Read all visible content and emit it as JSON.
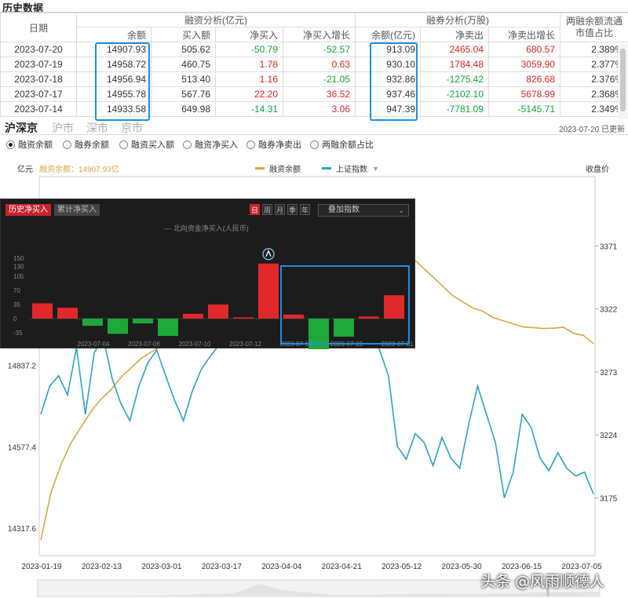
{
  "header": {
    "title": "历史数据"
  },
  "table": {
    "group_headers": {
      "date": "日期",
      "financing": "融资分析(亿元)",
      "securities": "融券分析(万股)",
      "ratio": "两融余额流通市值占比"
    },
    "columns": [
      "余额",
      "买入额",
      "净买入",
      "净买入增长",
      "余额(亿元)",
      "净卖出",
      "净卖出增长"
    ],
    "rows": [
      {
        "date": "2023-07-20",
        "fin_balance": "14907.93",
        "buy": "505.62",
        "net_buy": "-50.79",
        "net_buy_growth": "-52.57",
        "sec_balance": "913.09",
        "net_sell": "2465.04",
        "net_sell_growth": "680.57",
        "ratio": "2.389%"
      },
      {
        "date": "2023-07-19",
        "fin_balance": "14958.72",
        "buy": "460.75",
        "net_buy": "1.78",
        "net_buy_growth": "0.63",
        "sec_balance": "930.10",
        "net_sell": "1784.48",
        "net_sell_growth": "3059.90",
        "ratio": "2.377%"
      },
      {
        "date": "2023-07-18",
        "fin_balance": "14956.94",
        "buy": "513.40",
        "net_buy": "1.16",
        "net_buy_growth": "-21.05",
        "sec_balance": "932.86",
        "net_sell": "-1275.42",
        "net_sell_growth": "826.68",
        "ratio": "2.376%"
      },
      {
        "date": "2023-07-17",
        "fin_balance": "14955.78",
        "buy": "567.76",
        "net_buy": "22.20",
        "net_buy_growth": "36.52",
        "sec_balance": "937.46",
        "net_sell": "-2102.10",
        "net_sell_growth": "5678.99",
        "ratio": "2.368%"
      },
      {
        "date": "2023-07-14",
        "fin_balance": "14933.58",
        "buy": "649.98",
        "net_buy": "-14.31",
        "net_buy_growth": "3.06",
        "sec_balance": "947.39",
        "net_sell": "-7781.09",
        "net_sell_growth": "-5145.71",
        "ratio": "2.349%"
      }
    ]
  },
  "market_tabs": [
    {
      "label": "沪深京",
      "active": true
    },
    {
      "label": "沪市",
      "active": false
    },
    {
      "label": "深市",
      "active": false
    },
    {
      "label": "京市",
      "active": false
    }
  ],
  "updated": "2023-07-20 已更新",
  "radio_options": [
    {
      "label": "融资余额",
      "selected": true
    },
    {
      "label": "融券余额",
      "selected": false
    },
    {
      "label": "融资买入额",
      "selected": false
    },
    {
      "label": "融资净买入",
      "selected": false
    },
    {
      "label": "融券净卖出",
      "selected": false
    },
    {
      "label": "两融余额占比",
      "selected": false
    }
  ],
  "main_legend": {
    "unit": "亿元",
    "current": "融资余额：14907.93亿",
    "series_a": "融资余额",
    "series_b": "上证指数",
    "right_title": "收盘价"
  },
  "overlay": {
    "tab_active": "历史净买入",
    "tab_other": "累计净买入",
    "periods": [
      "日",
      "周",
      "月",
      "季",
      "年"
    ],
    "select_label": "叠加指数",
    "legend": "北向资金净买入(人民币)"
  },
  "watermark": "头条 @风雨顺德人",
  "colors": {
    "gold": "#d8a740",
    "blue": "#2aa3c6",
    "red": "#e0232b",
    "green": "#15a33a",
    "highlight": "#1a8fe3"
  },
  "chart_data": [
    {
      "type": "line",
      "title": "",
      "x_ticks": [
        "2023-01-19",
        "2023-02-13",
        "2023-03-01",
        "2023-03-17",
        "2023-04-04",
        "2023-04-21",
        "2023-05-12",
        "2023-05-30",
        "2023-06-15",
        "2023-07-05"
      ],
      "left_axis": {
        "unit": "亿元",
        "ticks": [
          14317.6,
          14577.4,
          14837.2
        ],
        "ylim": [
          14230,
          15440
        ]
      },
      "right_axis": {
        "title": "收盘价",
        "ticks": [
          3175,
          3224,
          3273,
          3322,
          3371
        ],
        "ylim": [
          3130,
          3425
        ]
      },
      "series": [
        {
          "name": "融资余额",
          "axis": "left",
          "color": "#d8a740",
          "values": [
            14280,
            14430,
            14520,
            14590,
            14640,
            14690,
            14730,
            14760,
            14800,
            14830,
            14860,
            14880,
            14900,
            14920,
            14960,
            15000,
            15050,
            15110,
            15170,
            15230,
            15290,
            15300,
            15330,
            15320,
            15300,
            15330,
            15310,
            15290,
            15300,
            15320,
            15300,
            15270,
            15260,
            15250,
            15220,
            15210,
            15200,
            15180,
            15150,
            15120,
            15090,
            15060,
            15040,
            15020,
            15010,
            14990,
            14980,
            14970,
            14960,
            14958,
            14955,
            14956,
            14959,
            14940,
            14933,
            14907
          ]
        },
        {
          "name": "上证指数",
          "axis": "right",
          "color": "#2aa3c6",
          "values": [
            3240,
            3262,
            3270,
            3255,
            3292,
            3240,
            3288,
            3300,
            3268,
            3248,
            3235,
            3262,
            3280,
            3290,
            3270,
            3251,
            3235,
            3258,
            3275,
            3285,
            3294,
            3300,
            3310,
            3322,
            3330,
            3340,
            3336,
            3348,
            3330,
            3320,
            3345,
            3355,
            3325,
            3310,
            3300,
            3330,
            3342,
            3318,
            3290,
            3270,
            3215,
            3205,
            3225,
            3218,
            3200,
            3222,
            3206,
            3198,
            3232,
            3262,
            3240,
            3218,
            3175,
            3195,
            3240,
            3230,
            3206,
            3196,
            3210,
            3198,
            3192,
            3195,
            3178
          ]
        }
      ]
    },
    {
      "type": "bar",
      "title": "北向资金净买入(人民币)",
      "categories": [
        "2023-07-03",
        "2023-07-04",
        "2023-07-05",
        "2023-07-06",
        "2023-07-07",
        "2023-07-10",
        "2023-07-11",
        "2023-07-12",
        "2023-07-13",
        "2023-07-14",
        "2023-07-17",
        "2023-07-18",
        "2023-07-19",
        "2023-07-20",
        "2023-07-21"
      ],
      "x_tick_labels": [
        "2023-07-04",
        "2023-07-06",
        "2023-07-10",
        "2023-07-12",
        "2023-07-14",
        "2023-07-19",
        "2023-07-21"
      ],
      "y_ticks": [
        -35,
        0,
        35,
        70,
        105,
        130,
        150
      ],
      "ylim": [
        -45,
        160
      ],
      "values": [
        38,
        27,
        -18,
        -38,
        -12,
        -43,
        12,
        35,
        3,
        137,
        10,
        -83,
        -45,
        5,
        58
      ]
    }
  ]
}
